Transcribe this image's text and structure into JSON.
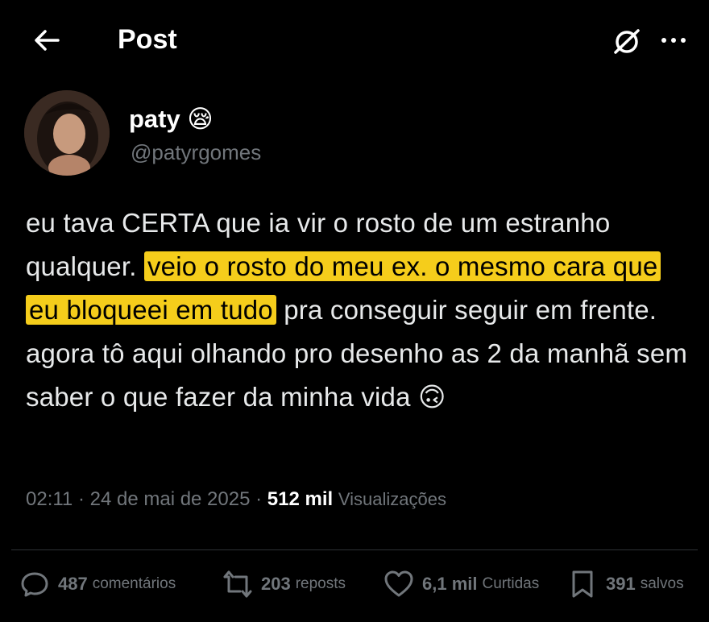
{
  "header": {
    "title": "Post"
  },
  "author": {
    "display_name": "paty",
    "emoji": "😪",
    "handle": "@patyrgomes"
  },
  "tweet": {
    "text_before": "eu tava CERTA que ia vir o rosto de um estranho qualquer. ",
    "text_highlighted": "veio o rosto do meu ex. o mesmo cara que eu bloqueei em tudo",
    "text_after": " pra conseguir seguir em frente. agora tô aqui olhando pro desenho as 2 da manhã sem saber o que fazer da minha vida ",
    "end_emoji": "🙃",
    "highlight_color": "#f5cd1b"
  },
  "meta": {
    "time": "02:11",
    "separator": "·",
    "date": "24 de mai de 2025",
    "views_count": "512 mil",
    "views_label": "Visualizações"
  },
  "actions": {
    "comments": {
      "count": "487",
      "label": "comentários",
      "icon": "comment-icon"
    },
    "reposts": {
      "count": "203",
      "label": "reposts",
      "icon": "repost-icon"
    },
    "likes": {
      "count": "6,1 mil",
      "label": "Curtidas",
      "icon": "heart-icon"
    },
    "bookmarks": {
      "count": "391",
      "label": "salvos",
      "icon": "bookmark-icon"
    }
  },
  "colors": {
    "background": "#000000",
    "text": "#e7e9ea",
    "muted": "#71767b",
    "divider": "#2f3336"
  }
}
